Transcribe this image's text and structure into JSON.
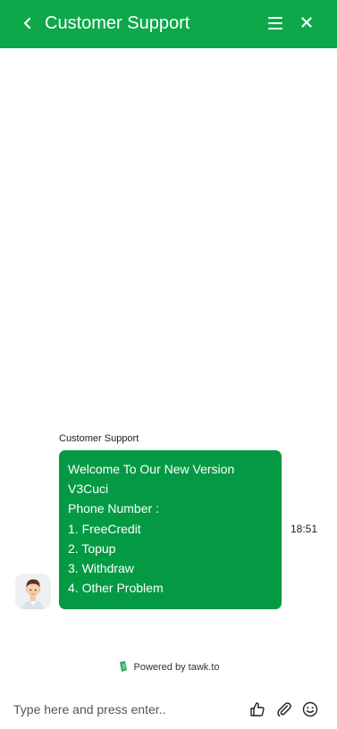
{
  "header": {
    "title": "Customer Support",
    "back_icon": "chevron-left-icon",
    "menu_icon": "hamburger-menu-icon",
    "close_icon": "close-icon",
    "background": "#0ea84a"
  },
  "conversation": {
    "sender_name": "Customer Support",
    "avatar_icon": "agent-avatar-icon",
    "bubble_color": "#049a44",
    "message_lines": [
      "Welcome To Our New Version",
      "V3Cuci",
      "Phone Number :",
      "1. FreeCredit",
      "2. Topup",
      "3. Withdraw",
      "4. Other Problem"
    ],
    "timestamp": "18:51"
  },
  "branding": {
    "powered_text": "Powered by tawk.to",
    "logo_icon": "tawk-logo-icon"
  },
  "composer": {
    "placeholder": "Type here and press enter..",
    "value": "",
    "rate_icon": "thumbs-up-icon",
    "attach_icon": "paperclip-icon",
    "emoji_icon": "smiley-icon"
  }
}
